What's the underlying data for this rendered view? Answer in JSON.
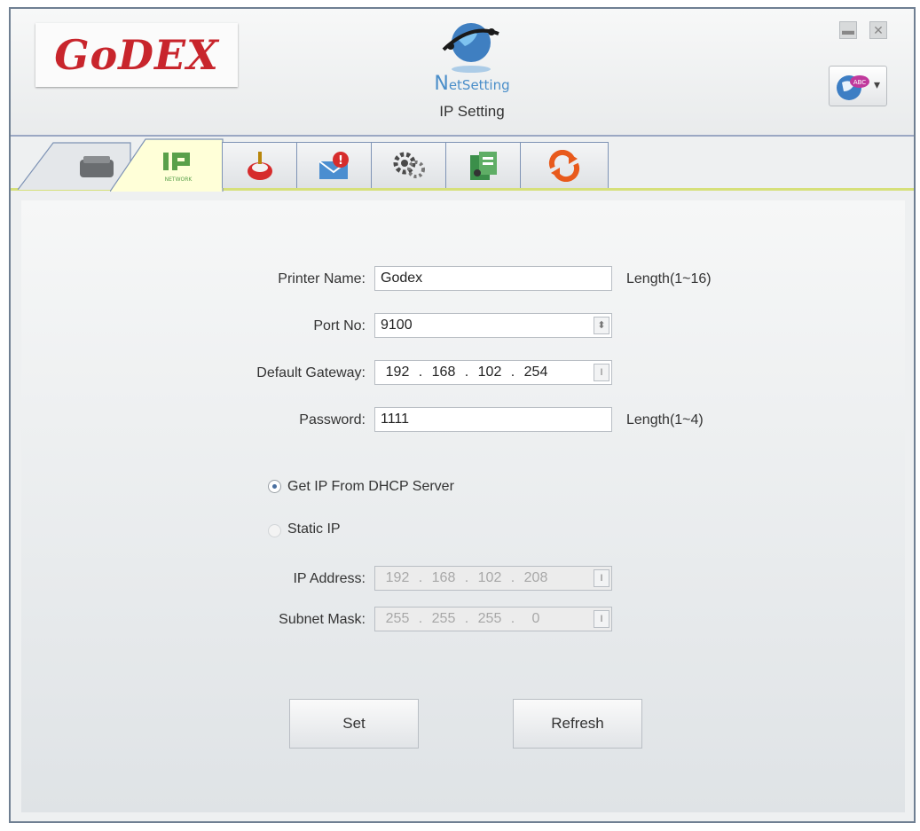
{
  "header": {
    "logo_text": "GoDEX",
    "app_name_cap": "N",
    "app_name_rest": "etSetting",
    "title": "IP Setting"
  },
  "window_controls": {
    "minimize_icon": "minimize-icon",
    "close_icon": "close-icon"
  },
  "language_button": {
    "icon": "globe-abc-icon",
    "arrow": "▾"
  },
  "tabs": [
    {
      "icon": "printer-icon"
    },
    {
      "icon": "ip-network-icon",
      "sublabel": "NETWORK",
      "active": true
    },
    {
      "icon": "alert-bell-icon"
    },
    {
      "icon": "email-alert-icon"
    },
    {
      "icon": "gears-icon"
    },
    {
      "icon": "security-key-icon"
    },
    {
      "icon": "refresh-icon"
    }
  ],
  "form": {
    "printer_name_label": "Printer Name:",
    "printer_name_value": "Godex",
    "printer_name_hint": "Length(1~16)",
    "port_label": "Port No:",
    "port_value": "9100",
    "gateway_label": "Default Gateway:",
    "gateway": [
      "192",
      "168",
      "102",
      "254"
    ],
    "password_label": "Password:",
    "password_value": "1111",
    "password_hint": "Length(1~4)",
    "dhcp_label": "Get IP From DHCP Server",
    "static_label": "Static IP",
    "ip_label": "IP Address:",
    "ip": [
      "192",
      "168",
      "102",
      "208"
    ],
    "mask_label": "Subnet Mask:",
    "mask": [
      "255",
      "255",
      "255",
      "0"
    ],
    "ip_sep": "."
  },
  "buttons": {
    "set": "Set",
    "refresh": "Refresh"
  },
  "colors": {
    "brand_red": "#c8252c",
    "tab_border": "#7e93b5",
    "active_tab": "#ffffd8",
    "accent_line": "#d6e07a"
  }
}
